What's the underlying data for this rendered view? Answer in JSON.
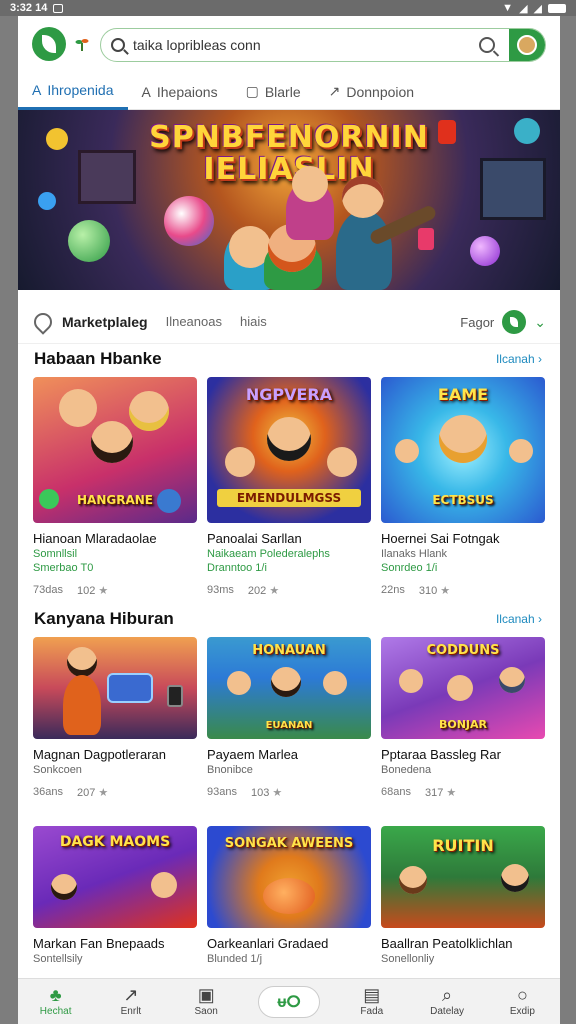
{
  "status": {
    "time": "3:32 14",
    "badge": "□"
  },
  "search": {
    "text": "taika lopribleas conn"
  },
  "tabs": [
    {
      "label": "Ihropenida",
      "icon": "A"
    },
    {
      "label": "Ihepaions",
      "icon": "A"
    },
    {
      "label": "Blarle",
      "icon": "▢"
    },
    {
      "label": "Donnpoion",
      "icon": "↗"
    }
  ],
  "banner": {
    "title_line1": "SPNBFENORNIN",
    "title_line2": "IELIASLIN"
  },
  "filter": {
    "main": "Marketplaleg",
    "sub1": "Ilneanoas",
    "sub2": "hiais",
    "right": "Fagor"
  },
  "sections": [
    {
      "title": "Habaan Hbanke",
      "see_all": "Ilcanah",
      "cards": [
        {
          "title": "Hianoan Mlaradaolae",
          "tag": "Somnllsil",
          "sub": "Smerbao T0",
          "rating": "73das",
          "count": "102",
          "thumb_text": "HANGRANE",
          "colors": [
            "#e65a3a",
            "#7a2fa8"
          ]
        },
        {
          "title": "Panoalai Sarllan",
          "tag": "Naikaeam Polederalephs",
          "sub": "Dranntoo 1/i",
          "rating": "93ms",
          "count": "202",
          "thumb_top": "NGPVERA",
          "thumb_text": "EMENDULMGSS",
          "colors": [
            "#2c2fa0",
            "#e0621c"
          ]
        },
        {
          "title": "Hoernei Sai Fotngak",
          "tag": "Ilanaks Hlank",
          "sub": "Sonrdeo 1/i",
          "rating": "22ns",
          "count": "310",
          "thumb_top": "EAME",
          "thumb_text": "ECTBSUS",
          "colors": [
            "#38b8e8",
            "#2b5ad0"
          ]
        }
      ]
    },
    {
      "title": "Kanyana Hiburan",
      "see_all": "Ilcanah",
      "cards": [
        {
          "title": "Magnan Dagpotleraran",
          "tag": "",
          "sub": "Sonkcoen",
          "rating": "36ans",
          "count": "207",
          "thumb_text": "",
          "colors": [
            "#e8743a",
            "#5a2a8a"
          ]
        },
        {
          "title": "Payaem Marlea",
          "tag": "",
          "sub": "Bnonibce",
          "rating": "93ans",
          "count": "103",
          "thumb_top": "HONAUAN",
          "thumb_text": "EUANAN",
          "colors": [
            "#2c7ad6",
            "#e0a020"
          ]
        },
        {
          "title": "Pptaraa Bassleg Rar",
          "tag": "",
          "sub": "Bonedena",
          "rating": "68ans",
          "count": "317",
          "thumb_top": "CODDUNS",
          "thumb_text": "BONJAR",
          "colors": [
            "#7a3ab8",
            "#e84ab0"
          ]
        }
      ]
    },
    {
      "title": "",
      "see_all": "",
      "cards": [
        {
          "title": "Markan Fan Bnepaads",
          "tag": "",
          "sub": "Sontellsily",
          "thumb_top": "DAGK MAOMS",
          "thumb_text": "",
          "colors": [
            "#6a2ab8",
            "#e0321c"
          ]
        },
        {
          "title": "Oarkeanlari Gradaed",
          "tag": "",
          "sub": "Blunded 1/j",
          "thumb_top": "SONGAK AWEENS",
          "thumb_text": "",
          "colors": [
            "#2c4ad0",
            "#e07a1c"
          ]
        },
        {
          "title": "Baallran Peatolklichlan",
          "tag": "",
          "sub": "Sonellonliy",
          "thumb_top": "RUITIN",
          "thumb_text": "",
          "colors": [
            "#3aa84a",
            "#c84a1c"
          ]
        }
      ]
    }
  ],
  "nav": [
    {
      "label": "Hechat",
      "glyph": "♣"
    },
    {
      "label": "Enrlt",
      "glyph": "↗"
    },
    {
      "label": "Saon",
      "glyph": "▣"
    },
    {
      "label": "",
      "glyph": "ᵾⵔ"
    },
    {
      "label": "Fada",
      "glyph": "▤"
    },
    {
      "label": "Datelay",
      "glyph": "⌕"
    },
    {
      "label": "Exdip",
      "glyph": "○"
    }
  ],
  "colors": {
    "accent": "#2e9a44",
    "link": "#1f6fb2"
  }
}
